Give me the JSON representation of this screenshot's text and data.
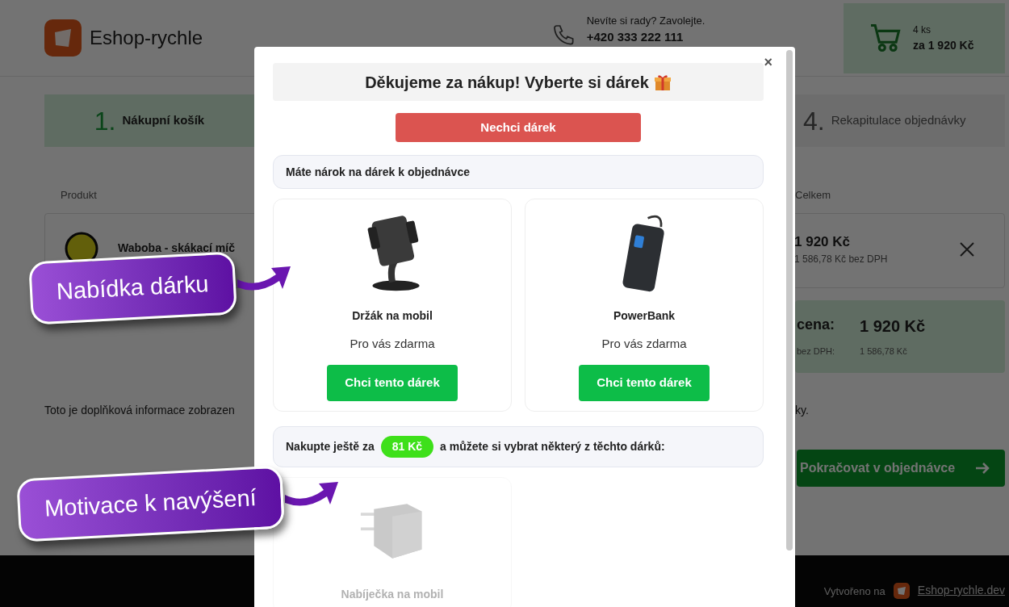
{
  "header": {
    "logo_text": "Eshop-rychle",
    "help_text": "Nevíte si rady? Zavolejte.",
    "phone": "+420 333 222 111",
    "cart": {
      "count": "4 ks",
      "total": "za 1 920 Kč"
    }
  },
  "steps": [
    {
      "number": "1.",
      "label": "Nákupní košík",
      "selected": true
    },
    {
      "number": "4.",
      "label": "Rekapitulace objednávky",
      "selected": false
    }
  ],
  "table": {
    "columns": [
      "Produkt",
      "Celkem"
    ],
    "rows": [
      {
        "name": "Waboba - skákací míč",
        "total": "1 920 Kč",
        "total_net": "1 586,78 Kč bez DPH"
      }
    ]
  },
  "summary": {
    "total_label": "cena:",
    "total": "1 920 Kč",
    "net_label": "bez DPH:",
    "net": "1 586,78 Kč"
  },
  "info_text": [
    "Toto je doplňková informace zobrazen",
    "ky."
  ],
  "continue_button": "Pokračovat v objednávce",
  "footer": {
    "text": "Vytvořeno na",
    "link": "Eshop-rychle.dev"
  },
  "modal": {
    "title": "Děkujeme za nákup! Vyberte si dárek",
    "close": "×",
    "decline_button": "Nechci dárek",
    "sections": [
      {
        "kind": "eligible",
        "heading": "Máte nárok na dárek k objednávce",
        "gifts": [
          {
            "kind": "holder",
            "name": "Držák na mobil",
            "note": "Pro vás zdarma",
            "button": "Chci tento dárek",
            "disabled": false
          },
          {
            "kind": "powerbank",
            "name": "PowerBank",
            "note": "Pro vás zdarma",
            "button": "Chci tento dárek",
            "disabled": false
          }
        ]
      },
      {
        "kind": "upsell",
        "heading_before": "Nakupte ještě za",
        "amount": "81 Kč",
        "heading_after": "a můžete si vybrat některý z těchto dárků:",
        "gifts": [
          {
            "kind": "charger",
            "name": "Nabíječka na mobil",
            "disabled": true
          }
        ]
      }
    ]
  },
  "callouts": [
    {
      "text": "Nabídka dárku"
    },
    {
      "text": "Motivace k navýšení"
    }
  ]
}
